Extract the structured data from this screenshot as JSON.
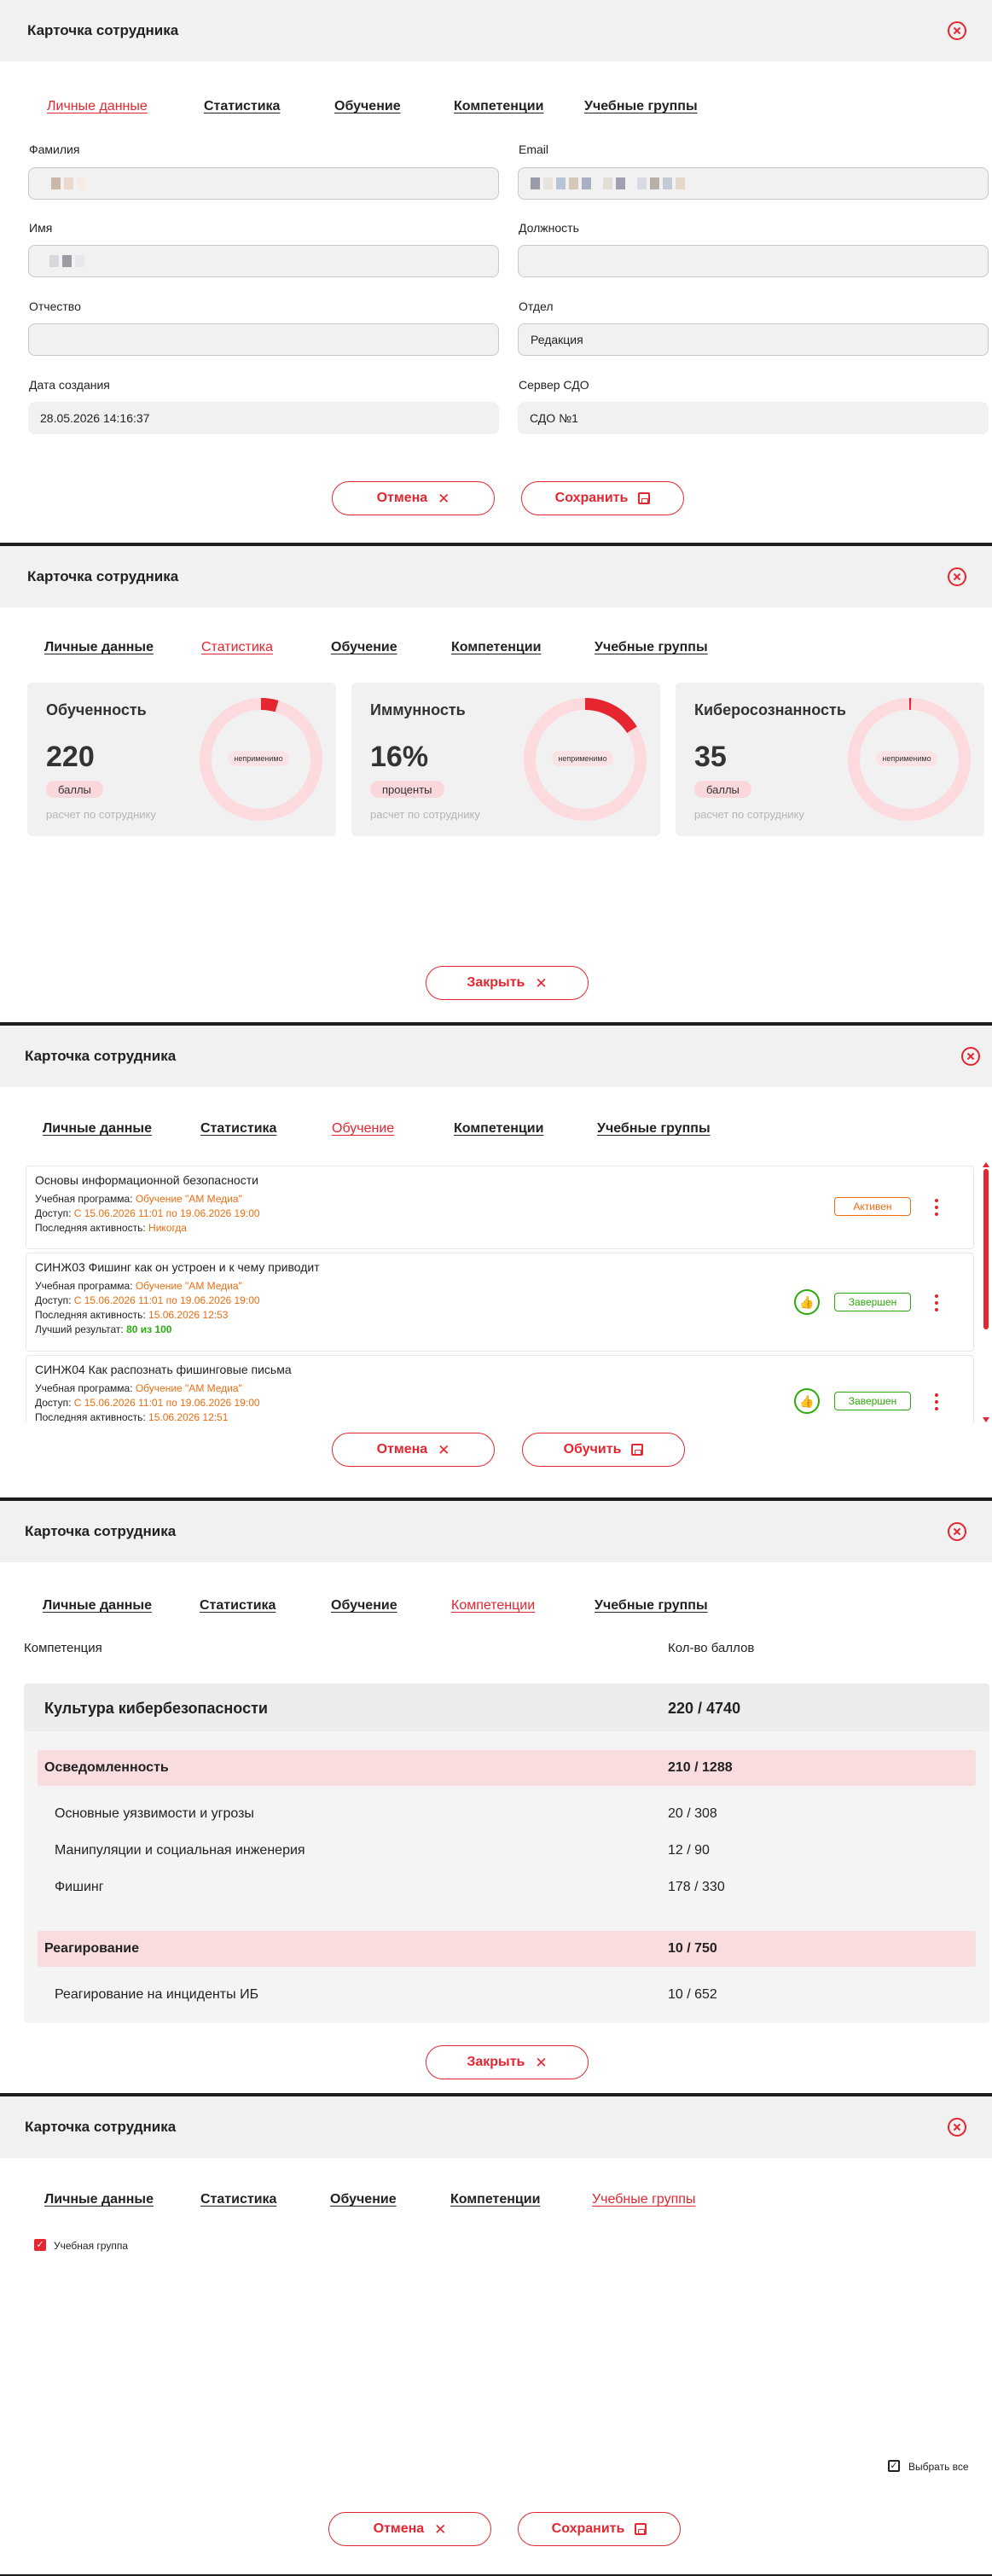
{
  "modal_title": "Карточка сотрудника",
  "tabs": [
    "Личные данные",
    "Статистика",
    "Обучение",
    "Компетенции",
    "Учебные группы"
  ],
  "buttons": {
    "cancel": "Отмена",
    "save": "Сохранить",
    "close": "Закрыть",
    "train": "Обучить"
  },
  "personal": {
    "last_name_label": "Фамилия",
    "email_label": "Email",
    "first_name_label": "Имя",
    "position_label": "Должность",
    "patronymic_label": "Отчество",
    "department_label": "Отдел",
    "department_value": "Редакция",
    "created_label": "Дата создания",
    "created_value": "28.05.2026 14:16:37",
    "server_label": "Сервер СДО",
    "server_value": "СДО №1",
    "redacted_colors": [
      "#c9b8a8",
      "#e9d9cf",
      "#9a9aa8",
      "#e8e2dc",
      "#b6c4d6",
      "#a8b0c4",
      "#9f9fb0"
    ]
  },
  "stats": {
    "donut_label": "неприменимо",
    "note": "расчет по сотруднику",
    "accent": "#e5252f",
    "track": "#fcdadd",
    "cards": [
      {
        "title": "Обученность",
        "value": "220",
        "unit": "баллы",
        "fraction": 0.046
      },
      {
        "title": "Иммунность",
        "value": "16%",
        "unit": "проценты",
        "fraction": 0.16
      },
      {
        "title": "Киберосознанность",
        "value": "35",
        "unit": "баллы",
        "fraction": 0.005
      }
    ]
  },
  "learning": {
    "program_label": "Учебная программа:",
    "access_label": "Доступ:",
    "activity_label": "Последняя активность:",
    "best_label": "Лучший результат:",
    "courses": [
      {
        "name": "Основы информационной безопасности",
        "program": "Обучение \"АМ Медиа\"",
        "access": "С 15.06.2026 11:01 по 19.06.2026 19:00",
        "activity": "Никогда",
        "best": "",
        "status": "Активен"
      },
      {
        "name": "СИНЖ03 Фишинг как он устроен и к чему приводит",
        "program": "Обучение \"АМ Медиа\"",
        "access": "С 15.06.2026 11:01 по 19.06.2026 19:00",
        "activity": "15.06.2026 12:53",
        "best": "80 из 100",
        "status": "Завершен"
      },
      {
        "name": "СИНЖ04 Как распознать фишинговые письма",
        "program": "Обучение \"АМ Медиа\"",
        "access": "С 15.06.2026 11:01 по 19.06.2026 19:00",
        "activity": "15.06.2026 12:51",
        "best": "",
        "status": "Завершен"
      }
    ]
  },
  "competencies": {
    "col_name": "Компетенция",
    "col_score": "Кол-во баллов",
    "root": {
      "name": "Культура кибербезопасности",
      "score": "220 / 4740"
    },
    "groups": [
      {
        "name": "Осведомленность",
        "score": "210 / 1288",
        "items": [
          {
            "name": "Основные уязвимости и угрозы",
            "score": "20 / 308"
          },
          {
            "name": "Манипуляции и социальная инженерия",
            "score": "12 / 90"
          },
          {
            "name": "Фишинг",
            "score": "178 / 330"
          }
        ]
      },
      {
        "name": "Реагирование",
        "score": "10 / 750",
        "items": [
          {
            "name": "Реагирование на инциденты ИБ",
            "score": "10 / 652"
          }
        ]
      }
    ]
  },
  "groups_tab": {
    "group_label": "Учебная группа",
    "group_checked": true,
    "select_all_label": "Выбрать все",
    "select_all_checked": true
  }
}
